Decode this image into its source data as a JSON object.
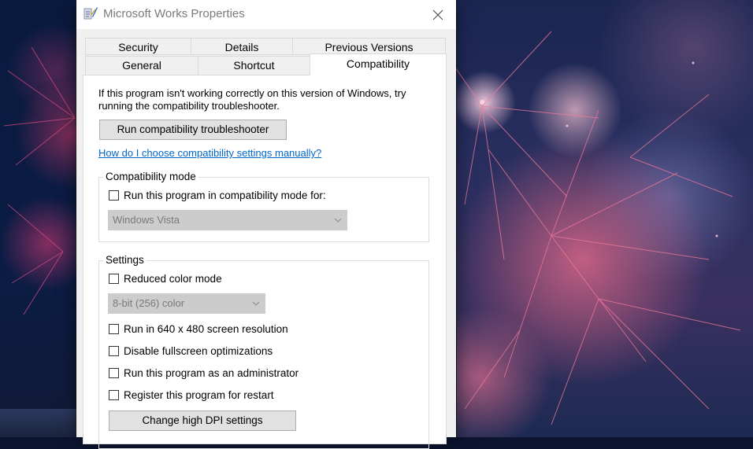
{
  "window": {
    "title": "Microsoft Works Properties"
  },
  "tabs": {
    "row1": [
      {
        "label": "Security"
      },
      {
        "label": "Details"
      },
      {
        "label": "Previous Versions"
      }
    ],
    "row2": [
      {
        "label": "General"
      },
      {
        "label": "Shortcut"
      },
      {
        "label": "Compatibility",
        "active": true
      }
    ]
  },
  "compat": {
    "intro": "If this program isn't working correctly on this version of Windows, try running the compatibility troubleshooter.",
    "troubleshooter_button": "Run compatibility troubleshooter",
    "manual_link": "How do I choose compatibility settings manually?",
    "mode_group": {
      "label": "Compatibility mode",
      "checkbox_label": "Run this program in compatibility mode for:",
      "checked": false,
      "os_select_value": "Windows Vista"
    },
    "settings_group": {
      "label": "Settings",
      "reduced_color": {
        "label": "Reduced color mode",
        "checked": false
      },
      "color_select_value": "8-bit (256) color",
      "res_640": {
        "label": "Run in 640 x 480 screen resolution",
        "checked": false
      },
      "fullscreen_opt": {
        "label": "Disable fullscreen optimizations",
        "checked": false
      },
      "run_admin": {
        "label": "Run this program as an administrator",
        "checked": false
      },
      "register_restart": {
        "label": "Register this program for restart",
        "checked": false
      },
      "dpi_button": "Change high DPI settings"
    }
  },
  "colors": {
    "link": "#0066cc",
    "button_bg": "#e1e1e1",
    "disabled_select_bg": "#cccccc"
  },
  "icons": [
    "works-app-icon",
    "close-icon",
    "chevron-down-icon"
  ]
}
